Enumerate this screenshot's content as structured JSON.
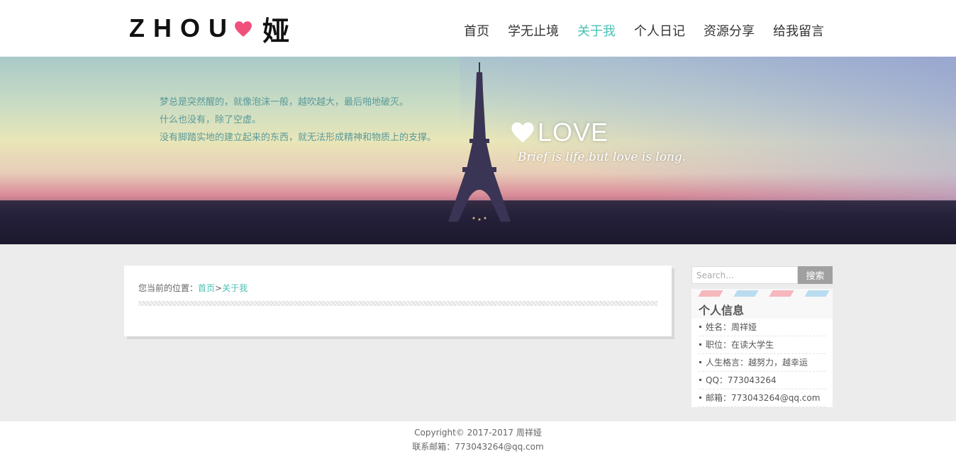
{
  "header": {
    "logo_text": "ZHOU",
    "logo_char": "娅",
    "nav": [
      {
        "label": "首页",
        "active": false
      },
      {
        "label": "学无止境",
        "active": false
      },
      {
        "label": "关于我",
        "active": true
      },
      {
        "label": "个人日记",
        "active": false
      },
      {
        "label": "资源分享",
        "active": false
      },
      {
        "label": "给我留言",
        "active": false
      }
    ]
  },
  "banner": {
    "lines": [
      "梦总是突然醒的，就像泡沫一般，越吹越大，最后啪地破灭。",
      "什么也没有，除了空虚。",
      "没有脚踏实地的建立起来的东西，就无法形成精神和物质上的支撑。"
    ],
    "love_title": "LOVE",
    "love_subtitle": "Brief is life,but love is long."
  },
  "breadcrumb": {
    "prefix": "您当前的位置：",
    "home": "首页",
    "separator": ">",
    "current": "关于我"
  },
  "search": {
    "placeholder": "Search...",
    "button": "搜索"
  },
  "profile": {
    "title": "个人信息",
    "items": [
      "姓名：周祥娅",
      "职位：在读大学生",
      "人生格言：越努力，越幸运",
      "QQ：773043264",
      "邮箱：773043264@qq.com"
    ]
  },
  "footer": {
    "copyright": "Copyright© 2017-2017 周祥娅",
    "email": "联系邮箱：773043264@qq.com"
  },
  "colors": {
    "accent": "#47c1b4",
    "heart": "#f0507c"
  }
}
